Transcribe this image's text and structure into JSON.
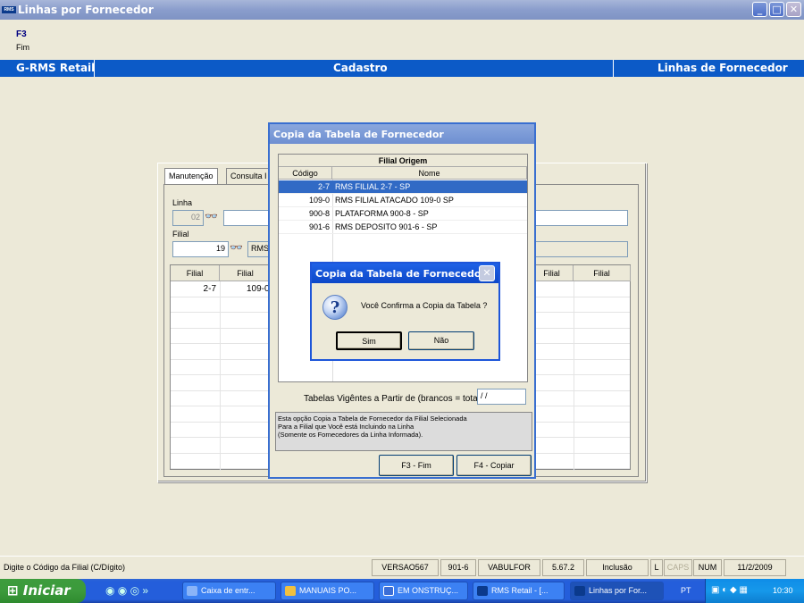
{
  "window": {
    "title": "Linhas por Fornecedor",
    "app_icon": "RMS",
    "controls": [
      "_",
      "□",
      "✕"
    ]
  },
  "function_key": {
    "key": "F3",
    "desc": "Fim"
  },
  "header": {
    "left": "G-RMS Retail",
    "center": "Cadastro",
    "right": "Linhas de Fornecedor"
  },
  "form": {
    "tabs": [
      "Manutenção",
      "Consulta I"
    ],
    "linha_label": "Linha",
    "linha_value": "02",
    "filial_label": "Filial",
    "filial_value": "19",
    "filial_name": "RMS",
    "grid": {
      "headers": [
        "Filial",
        "Filial",
        "Filial",
        "Filial"
      ],
      "rows": [
        [
          "2-7",
          "109-0"
        ]
      ]
    }
  },
  "copy_dialog": {
    "title": "Copia da Tabela de Fornecedor",
    "list_title": "Filial Origem",
    "col_codigo": "Código",
    "col_nome": "Nome",
    "rows": [
      {
        "code": "2-7",
        "name": "RMS FILIAL 2-7 - SP",
        "selected": true
      },
      {
        "code": "109-0",
        "name": "RMS FILIAL ATACADO 109-0 SP",
        "selected": false
      },
      {
        "code": "900-8",
        "name": "PLATAFORMA 900-8 - SP",
        "selected": false
      },
      {
        "code": "901-6",
        "name": "RMS DEPOSITO 901-6 - SP",
        "selected": false
      }
    ],
    "date_label": "Tabelas Vigêntes a Partir de (brancos = total)",
    "date_value": "/ /",
    "info": [
      "Esta opção Copia a Tabela de Fornecedor da Filial Selecionada",
      "Para a Filial que Você está Incluindo na Linha",
      "(Somente os Fornecedores da Linha Informada)."
    ],
    "btn_fim": "F3 - Fim",
    "btn_copiar": "F4 - Copiar"
  },
  "confirm": {
    "title": "Copia da Tabela de Fornecedor",
    "message": "Você Confirma a Copia da Tabela ?",
    "yes": "Sim",
    "no": "Não",
    "close": "✕",
    "icon": "?"
  },
  "status": {
    "hint": "Digite o Código da Filial (C/Dígito)",
    "version": "VERSAO567",
    "filial": "901-6",
    "program": "VABULFOR",
    "release": "5.67.2",
    "mode": "Inclusão",
    "l": "L",
    "caps": "CAPS",
    "num": "NUM",
    "date": "11/2/2009"
  },
  "taskbar": {
    "start": "Iniciar",
    "items": [
      "Caixa de entr...",
      "MANUAIS PO...",
      "EM ONSTRUÇ...",
      "RMS Retail - [...",
      "Linhas por For..."
    ],
    "lang": "PT",
    "clock": "10:30"
  },
  "colors": {
    "titlebar": "#8a9dcc",
    "header": "#0c5ac7",
    "selection": "#316ac5",
    "taskbar": "#245edb",
    "start": "#3c9a3c"
  }
}
